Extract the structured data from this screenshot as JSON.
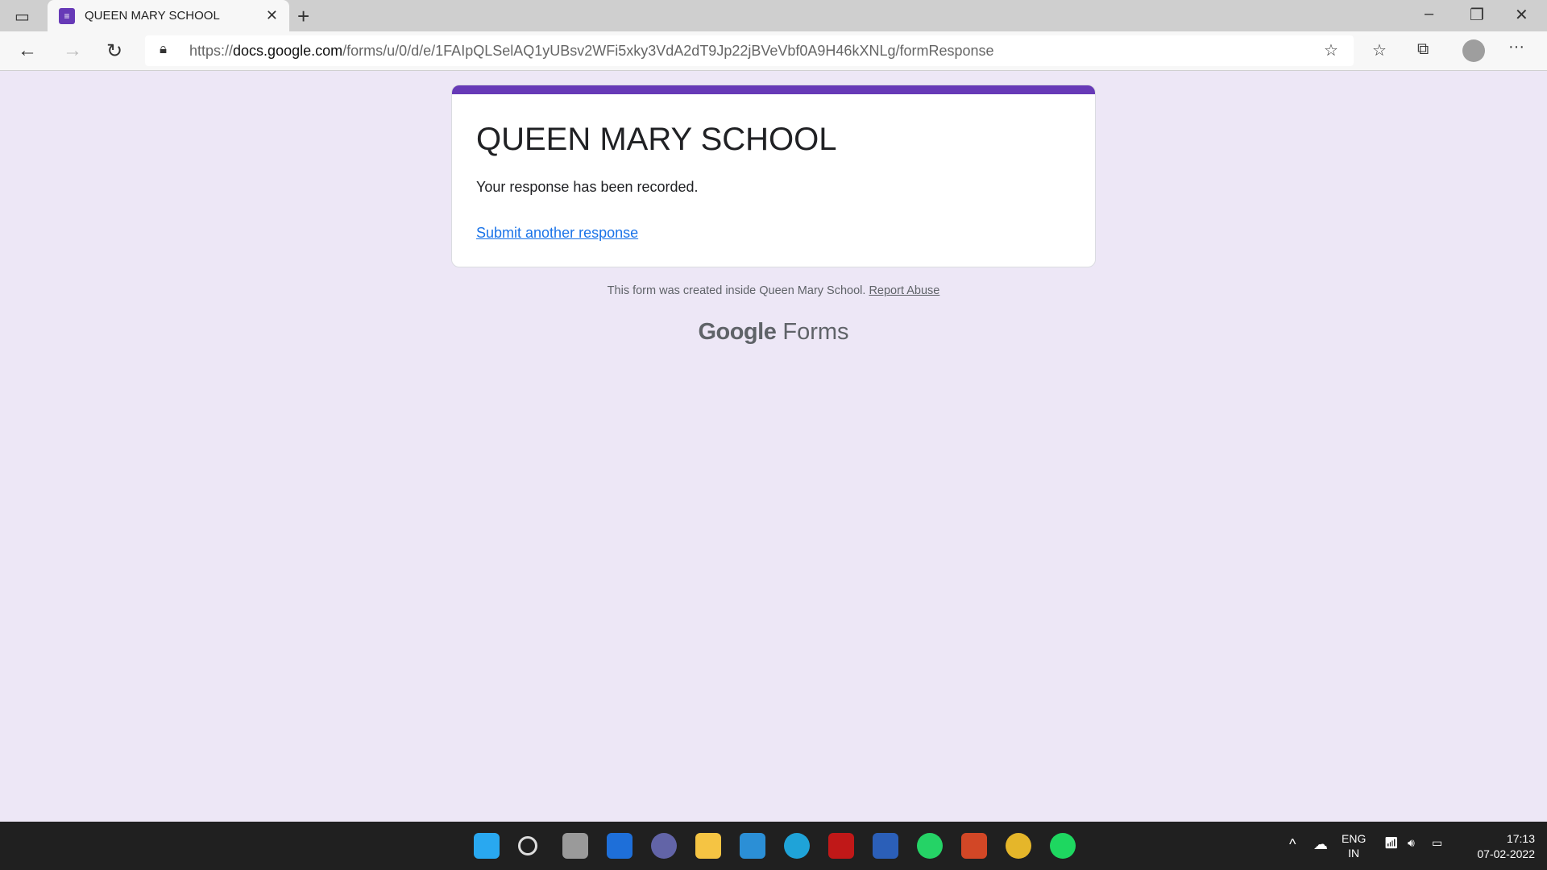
{
  "browser": {
    "tab_title": "QUEEN MARY SCHOOL",
    "url_prefix": "https://",
    "url_domain": "docs.google.com",
    "url_path": "/forms/u/0/d/e/1FAIpQLSelAQ1yUBsv2WFi5xky3VdA2dT9Jp22jBVeVbf0A9H46kXNLg/formResponse"
  },
  "form": {
    "title": "QUEEN MARY SCHOOL",
    "message": "Your response has been recorded.",
    "another_link": "Submit another response",
    "accent": "#673ab7"
  },
  "footer": {
    "text": "This form was created inside Queen Mary School.",
    "report": "Report Abuse"
  },
  "logo": {
    "google": "Google",
    "forms": "Forms"
  },
  "taskbar": {
    "apps": [
      {
        "name": "start",
        "color": "#29a8f0"
      },
      {
        "name": "search",
        "color": "#202020"
      },
      {
        "name": "task-view",
        "color": "#9a9a9a"
      },
      {
        "name": "widgets",
        "color": "#1e6fd9"
      },
      {
        "name": "teams-chat",
        "color": "#6264a7"
      },
      {
        "name": "file-explorer",
        "color": "#f5c443"
      },
      {
        "name": "get-help",
        "color": "#2b8fd6"
      },
      {
        "name": "edge",
        "color": "#1fa3d8"
      },
      {
        "name": "mcafee",
        "color": "#c01818"
      },
      {
        "name": "word",
        "color": "#2b5fb8"
      },
      {
        "name": "whatsapp",
        "color": "#25d366"
      },
      {
        "name": "powerpoint",
        "color": "#d24726"
      },
      {
        "name": "chrome",
        "color": "#e5b62a"
      },
      {
        "name": "spotify",
        "color": "#1ed760"
      }
    ],
    "lang": "ENG",
    "region": "IN",
    "time": "17:13",
    "date": "07-02-2022"
  }
}
